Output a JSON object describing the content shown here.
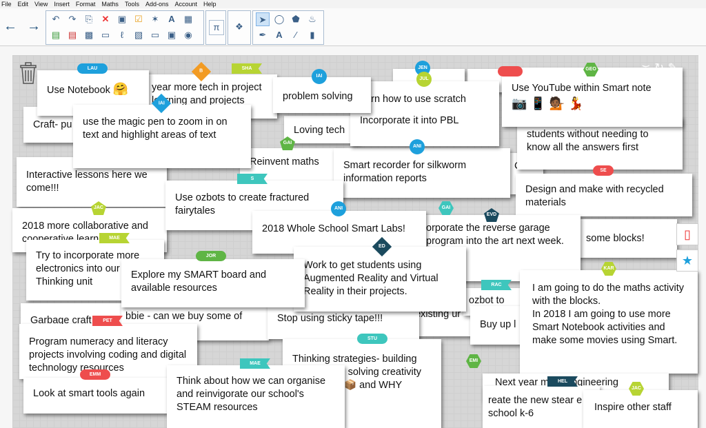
{
  "menu": [
    "File",
    "Edit",
    "View",
    "Insert",
    "Format",
    "Maths",
    "Tools",
    "Add-ons",
    "Account",
    "Help"
  ],
  "toolbar": {
    "back_icon": "arrow-left-icon",
    "forward_icon": "arrow-right-icon",
    "group1": [
      "undo",
      "redo",
      "paste",
      "delete",
      "screen-shade",
      "table-reveal",
      "magic-pen",
      "spell-check",
      "table",
      "add-page",
      "duplicate-page",
      "save",
      "screen",
      "attach",
      "display",
      "record",
      "fullscreen",
      "capture"
    ],
    "text_tool_label": "A",
    "maths_symbol": "π",
    "colors": {
      "accent": "#1e4f7a",
      "selected": "#cde3f7"
    }
  },
  "notes": [
    {
      "text": "Use Notebook",
      "emoji": "🤗"
    },
    {
      "text": "year more tech in project learning and projects"
    },
    {
      "text": "Craft- pu"
    },
    {
      "text": "use the magic pen to zoom in on text and highlight areas of text"
    },
    {
      "text": "problem solving"
    },
    {
      "text": "earn how to use scratch"
    },
    {
      "text": "Loving tech"
    },
    {
      "text": "Incorporate it into PBL"
    },
    {
      "text": "Use YouTube within Smart note",
      "emoji": "📷 📱 💁🏾 💃"
    },
    {
      "text": "students without needing to know all the answers first"
    },
    {
      "text": "Interactive lessons here we come!!!"
    },
    {
      "text": "Reinvent maths"
    },
    {
      "text": "Smart recorder for silkworm information reports"
    },
    {
      "text": "Design and make with recycled materials"
    },
    {
      "text": "Use ozbots to create fractured fairytales"
    },
    {
      "text": "2018 more collaborative and cooperative learning"
    },
    {
      "text": "2018 Whole School Smart Labs!"
    },
    {
      "text": "orporate the reverse garage program into the art next week."
    },
    {
      "text": "some blocks!"
    },
    {
      "text": "Try to incorporate more electronics into our Thinking unit"
    },
    {
      "text": "Explore my SMART board and available resources"
    },
    {
      "text": "Work to get students using Augmented Reality and Virtual Reality in their projects."
    },
    {
      "text": "ozbot to"
    },
    {
      "text": "I am going to do the maths activity with the blocks.\nIn 2018 I am going to use more Smart Notebook activities and make some movies using Smart."
    },
    {
      "text": "Garbage craft"
    },
    {
      "text": "bbie - can we buy some of shield?"
    },
    {
      "text": "Stop using sticky tape!!!"
    },
    {
      "text": "existing ur"
    },
    {
      "text": "Buy up l"
    },
    {
      "text": "Program numeracy and literacy projects involving coding and digital technology resources"
    },
    {
      "text": "Thinking strategies- building gained from solving creativity outside the",
      "emoji": "📦",
      "text2": "and WHY"
    },
    {
      "text": "Look at smart tools again"
    },
    {
      "text": "Think about how we can organise and reinvigorate our school's STEAM resources"
    },
    {
      "text": "Next year more engineering"
    },
    {
      "text": "reate the new stear e school k-6"
    },
    {
      "text": "Inspire other staff"
    }
  ],
  "tags": [
    "LAU",
    "B",
    "SHA",
    "IAI",
    "JEN",
    "JUL",
    "GEO",
    "IAI",
    "GAI",
    "ANI",
    "S",
    "JAC",
    "ANI",
    "GAI",
    "EVD",
    "SE",
    "MAE",
    "ED",
    "JOR",
    "KAR",
    "RAC",
    "PET",
    "STU",
    "MAE",
    "EMM",
    "EMI",
    "HEL",
    "JAC"
  ],
  "colors": {
    "blue": "#1ea0dc",
    "orange": "#f29b23",
    "lime": "#b7d433",
    "teal": "#3ec6bd",
    "green": "#5fb545",
    "navy": "#1b4a5e",
    "red": "#ee4d4d"
  }
}
